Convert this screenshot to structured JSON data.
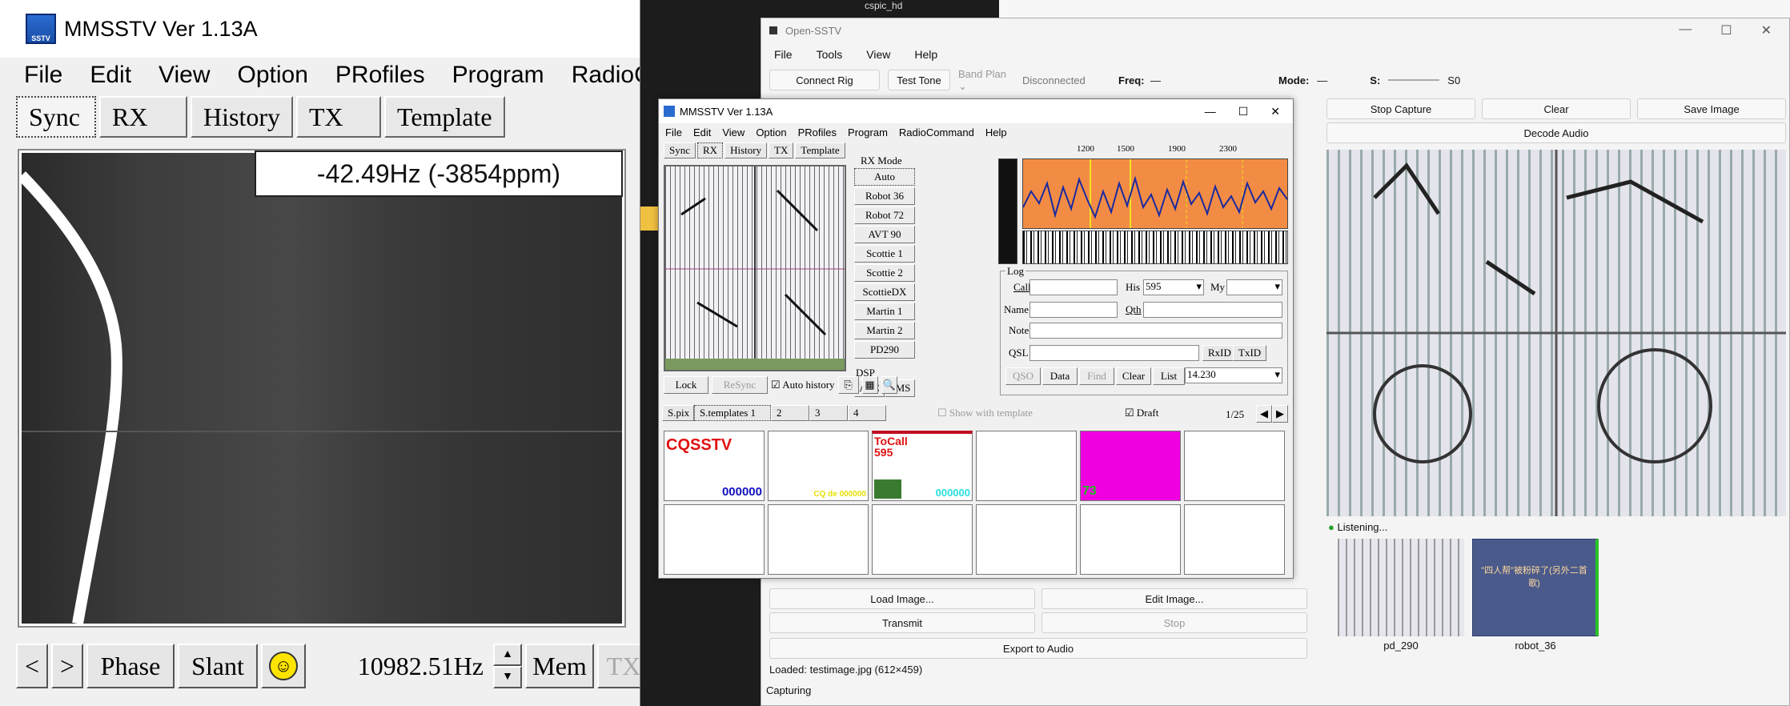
{
  "big_window": {
    "title": "MMSSTV Ver 1.13A",
    "icon": "sstv-app-icon",
    "icon_text": "SSTV",
    "menu": [
      "File",
      "Edit",
      "View",
      "Option",
      "PRofiles",
      "Program",
      "RadioCo"
    ],
    "tabs": [
      "Sync",
      "RX",
      "History",
      "TX",
      "Template"
    ],
    "active_tab": "Sync",
    "freq_readout": "-42.49Hz (-3854ppm)",
    "bottom": {
      "prev": "<",
      "next": ">",
      "phase": "Phase",
      "slant": "Slant",
      "freq": "10982.51Hz",
      "mem": "Mem",
      "tx": "TX"
    }
  },
  "top_bar_label": "cspic_hd",
  "open_sstv": {
    "title": "Open-SSTV",
    "menu": [
      "File",
      "Tools",
      "View",
      "Help"
    ],
    "toolbar": {
      "connect_rig": "Connect Rig",
      "test_tone": "Test Tone",
      "band_plan": "Band Plan",
      "status": "Disconnected",
      "freq_label": "Freq:",
      "freq_value": "—",
      "mode_label": "Mode:",
      "mode_value": "—",
      "s_label": "S:",
      "s_value": "S0"
    },
    "rx_buttons": {
      "stop_capture": "Stop Capture",
      "clear": "Clear",
      "save_image": "Save Image",
      "decode_audio": "Decode Audio"
    },
    "listening": "Listening...",
    "thumbnails": [
      {
        "label": "pd_290"
      },
      {
        "label": "robot_36",
        "text": "\"四人帮\"被粉碎了(另外二首歌)"
      }
    ],
    "tx_buttons": {
      "load_image": "Load Image...",
      "edit_image": "Edit Image...",
      "transmit": "Transmit",
      "stop": "Stop",
      "export": "Export to Audio"
    },
    "loaded": "Loaded: testimage.jpg  (612×459)",
    "status": "Capturing"
  },
  "small_window": {
    "title": "MMSSTV Ver 1.13A",
    "menu": [
      "File",
      "Edit",
      "View",
      "Option",
      "PRofiles",
      "Program",
      "RadioCommand",
      "Help"
    ],
    "tabs": [
      "Sync",
      "RX",
      "History",
      "TX",
      "Template"
    ],
    "active_tab": "RX",
    "rx_mode_label": "RX Mode",
    "modes": [
      "Auto",
      "Robot 36",
      "Robot 72",
      "AVT 90",
      "Scottie 1",
      "Scottie 2",
      "ScottieDX",
      "Martin 1",
      "Martin 2",
      "PD290"
    ],
    "dsp_label": "DSP",
    "dsp": [
      "AFC",
      "LMS"
    ],
    "spectrum_ticks": [
      "1200",
      "1500",
      "1900",
      "2300"
    ],
    "log": {
      "label": "Log",
      "call": "Call",
      "his": "His",
      "his_value": "595",
      "my": "My",
      "name": "Name",
      "qth": "Qth",
      "note": "Note",
      "qsl": "QSL",
      "rxid": "RxID",
      "txid": "TxID",
      "qso": "QSO",
      "data": "Data",
      "find": "Find",
      "clear": "Clear",
      "list": "List",
      "freq": "14.230"
    },
    "controls": {
      "lock": "Lock",
      "resync": "ReSync",
      "auto_history": "Auto history"
    },
    "template_tabs": [
      "S.pix",
      "S.templates 1",
      "2",
      "3",
      "4"
    ],
    "show_with_template": "Show with template",
    "draft": "Draft",
    "page": "1/25",
    "templates": {
      "cq": "CQSSTV",
      "cq_num": "000000",
      "cq_de": "CQ de 000000",
      "tocall": "ToCall",
      "tocall_num": "595",
      "tocall_zeros": "000000",
      "yellow_text": "",
      "magenta_num": "73"
    }
  }
}
